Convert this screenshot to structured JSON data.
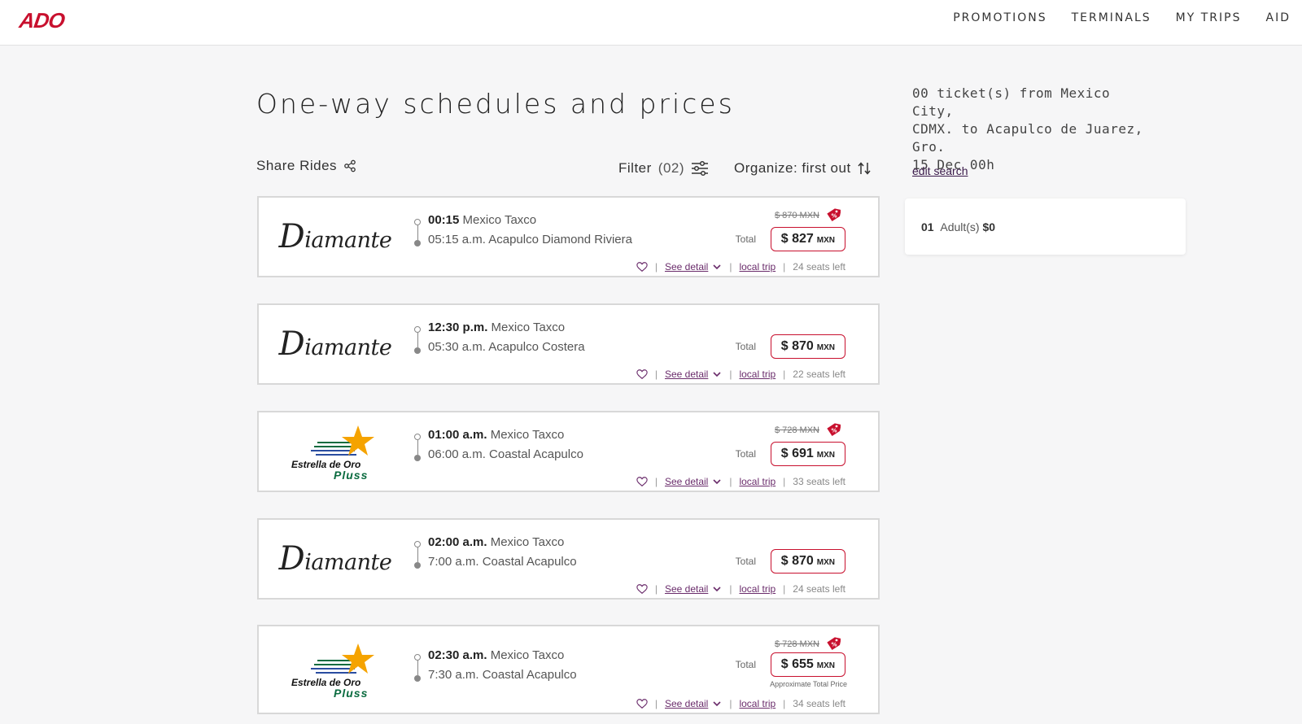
{
  "header": {
    "logo": "ADO",
    "nav": [
      "PROMOTIONS",
      "TERMINALS",
      "MY TRIPS",
      "AID"
    ]
  },
  "page": {
    "title": "One-way schedules and prices",
    "share_label": "Share Rides",
    "filter_label": "Filter",
    "filter_count": "(02)",
    "organize_label": "Organize: first out"
  },
  "trips": [
    {
      "brand": "Diamante",
      "depart_time": "00:15",
      "depart_place": "Mexico Taxco",
      "arrive": "05:15 a.m. Acapulco Diamond Riviera",
      "old_price": "$ 870 MXN",
      "total_label": "Total",
      "price": "$ 827",
      "currency": "MXN",
      "see_detail": "See detail",
      "trip_type": "local trip",
      "seats": "24 seats left"
    },
    {
      "brand": "Diamante",
      "depart_time": "12:30 p.m.",
      "depart_place": "Mexico Taxco",
      "arrive": "05:30 a.m. Acapulco Costera",
      "old_price": "",
      "total_label": "Total",
      "price": "$ 870",
      "currency": "MXN",
      "see_detail": "See detail",
      "trip_type": "local trip",
      "seats": "22 seats left"
    },
    {
      "brand": "Estrella de Oro Pluss",
      "brand_line1": "Estrella de Oro",
      "brand_line2": "Pluss",
      "depart_time": "01:00 a.m.",
      "depart_place": "Mexico Taxco",
      "arrive": "06:00 a.m. Coastal Acapulco",
      "old_price": "$ 728 MXN",
      "total_label": "Total",
      "price": "$ 691",
      "currency": "MXN",
      "see_detail": "See detail",
      "trip_type": "local trip",
      "seats": "33 seats left"
    },
    {
      "brand": "Diamante",
      "depart_time": "02:00 a.m.",
      "depart_place": "Mexico Taxco",
      "arrive": "7:00 a.m. Coastal Acapulco",
      "old_price": "",
      "total_label": "Total",
      "price": "$ 870",
      "currency": "MXN",
      "see_detail": "See detail",
      "trip_type": "local trip",
      "seats": "24 seats left"
    },
    {
      "brand": "Estrella de Oro Pluss",
      "brand_line1": "Estrella de Oro",
      "brand_line2": "Pluss",
      "depart_time": "02:30 a.m.",
      "depart_place": "Mexico Taxco",
      "arrive": "7:30 a.m. Coastal Acapulco",
      "old_price": "$ 728 MXN",
      "total_label": "Total",
      "price": "$ 655",
      "currency": "MXN",
      "approx": "Approximate Total Price",
      "see_detail": "See detail",
      "trip_type": "local trip",
      "seats": "34 seats left"
    }
  ],
  "sidebar": {
    "summary_line1": "00 ticket(s) from Mexico City,",
    "summary_line2": "CDMX. to Acapulco de Juarez,",
    "summary_line3": "Gro.",
    "summary_line4": "15 Dec 00h",
    "edit_search": "edit search",
    "passenger_count": "01",
    "passenger_label": "Adult(s)",
    "passenger_total": "$0"
  },
  "colors": {
    "brand_red": "#c8102e",
    "link_purple": "#6a2c6b"
  }
}
